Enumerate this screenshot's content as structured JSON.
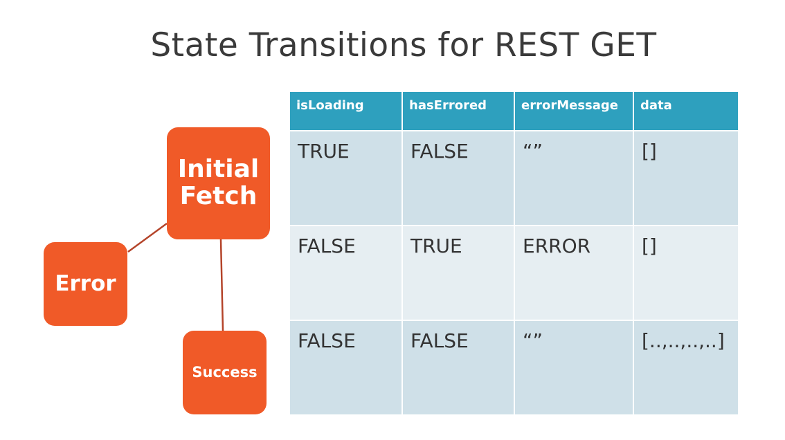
{
  "title": "State Transitions for REST GET",
  "colors": {
    "node_fill": "#f05a28",
    "connector": "#b4442a",
    "table_header": "#2ea0be",
    "table_row_light": "#e6eef2",
    "table_row_dark": "#cfe0e8"
  },
  "diagram": {
    "nodes": {
      "initial_fetch": "Initial\nFetch",
      "error": "Error",
      "success": "Success"
    }
  },
  "table": {
    "headers": [
      "isLoading",
      "hasErrored",
      "errorMessage",
      "data"
    ],
    "rows": [
      [
        "TRUE",
        "FALSE",
        "“”",
        "[]"
      ],
      [
        "FALSE",
        "TRUE",
        "ERROR",
        "[]"
      ],
      [
        "FALSE",
        "FALSE",
        "“”",
        "[..,..,..,..]"
      ]
    ]
  }
}
